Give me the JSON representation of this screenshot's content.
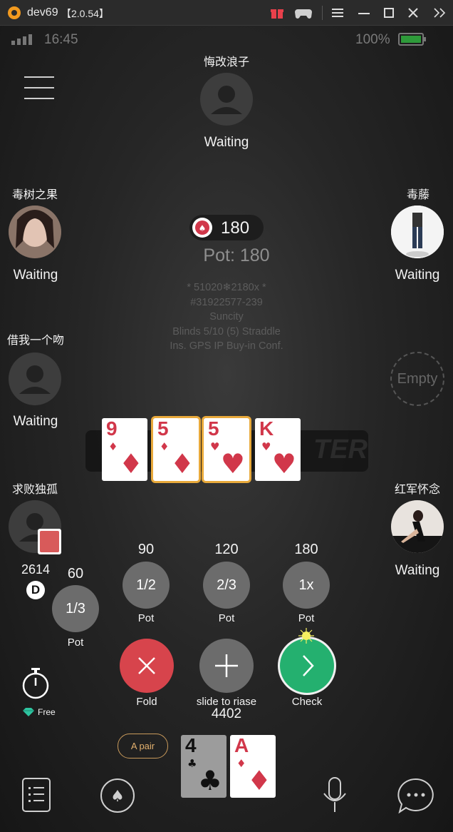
{
  "emulator": {
    "title": "dev69",
    "version": "【2.0.54】"
  },
  "status_bar": {
    "time": "16:45",
    "battery": "100%"
  },
  "players": {
    "top": {
      "name": "悔改浪子",
      "status": "Waiting"
    },
    "left1": {
      "name": "毒树之果",
      "status": "Waiting"
    },
    "right1": {
      "name": "毒藤",
      "status": "Waiting"
    },
    "left2": {
      "name": "借我一个吻",
      "status": "Waiting"
    },
    "right2": {
      "label": "Empty"
    },
    "left3": {
      "name": "求败独孤",
      "stack": "2614",
      "dealer": "D"
    },
    "right3": {
      "name": "红军怀念",
      "status": "Waiting"
    }
  },
  "pot": {
    "chips": "180",
    "label": "Pot: 180"
  },
  "table_info": {
    "line1": "* 51020❄2180x *",
    "line2": "#31922577-239",
    "line3": "Suncity",
    "line4": "Blinds 5/10 (5) Straddle",
    "line5": "Ins. GPS IP Buy-in Conf."
  },
  "watermark": "TER",
  "board": [
    {
      "rank": "9",
      "suit": "♦",
      "highlight": false
    },
    {
      "rank": "5",
      "suit": "♦",
      "highlight": true
    },
    {
      "rank": "5",
      "suit": "♥",
      "highlight": true
    },
    {
      "rank": "K",
      "suit": "♥",
      "highlight": false
    }
  ],
  "bet_presets": [
    {
      "amount": "60",
      "fraction": "1/3",
      "label": "Pot"
    },
    {
      "amount": "90",
      "fraction": "1/2",
      "label": "Pot"
    },
    {
      "amount": "120",
      "fraction": "2/3",
      "label": "Pot"
    },
    {
      "amount": "180",
      "fraction": "1x",
      "label": "Pot"
    }
  ],
  "actions": {
    "fold": "Fold",
    "raise": "slide to riase",
    "check": "Check",
    "stack": "4402"
  },
  "timer": {
    "label": "Free"
  },
  "hand_hint": "A pair",
  "hole_cards": [
    {
      "rank": "4",
      "suit": "♣"
    },
    {
      "rank": "A",
      "suit": "♦"
    }
  ],
  "colors": {
    "fold": "#d7444c",
    "check": "#24b06f",
    "highlight": "#e8a93b",
    "card_red": "#d1374a"
  }
}
